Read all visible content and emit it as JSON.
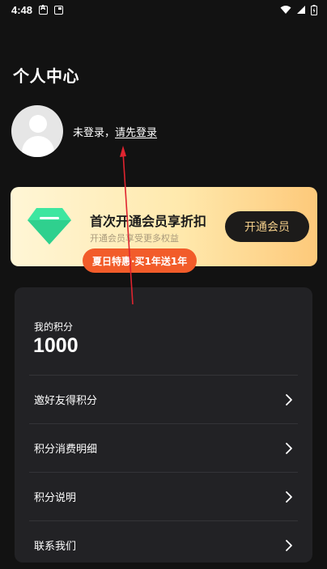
{
  "status_bar": {
    "time": "4:48",
    "icons": [
      "notification-a-icon",
      "notification-card-icon",
      "wifi-icon",
      "signal-icon",
      "battery-icon"
    ]
  },
  "header": {
    "title": "个人中心"
  },
  "user": {
    "status_text": "未登录，",
    "login_link": "请先登录"
  },
  "vip": {
    "title": "首次开通会员享折扣",
    "subtitle": "开通会员享受更多权益",
    "button_label": "开通会员",
    "promo_badge": "夏日特惠·买1年送1年",
    "colors": {
      "card_gradient_start": "#fff6d6",
      "card_gradient_end": "#fdc97a",
      "diamond": "#3ee6a0",
      "button_bg": "#1c1b1a",
      "button_text": "#f3cf8b",
      "badge_bg": "#f25c2a"
    }
  },
  "points": {
    "label": "我的积分",
    "value": "1000"
  },
  "menu": {
    "items": [
      {
        "label": "邀好友得积分"
      },
      {
        "label": "积分消费明细"
      },
      {
        "label": "积分说明"
      },
      {
        "label": "联系我们"
      }
    ]
  },
  "annotation": {
    "color": "#e0242f"
  }
}
